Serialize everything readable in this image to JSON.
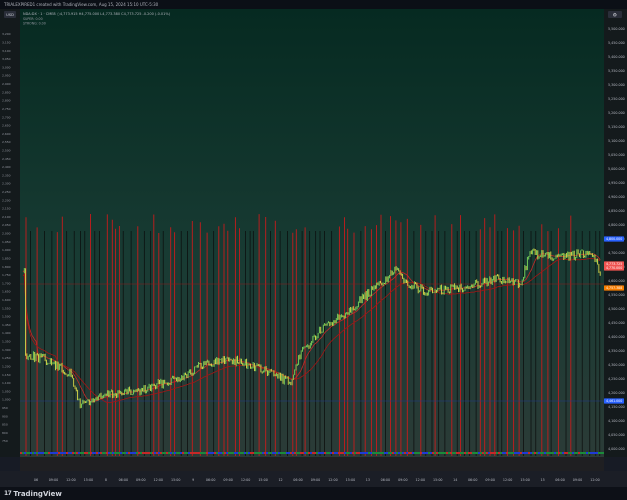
{
  "header": {
    "title": "TRIALEXPIRED1 created with TradingView.com, Aug 15, 2024 15:10 UTC-5:30"
  },
  "chart": {
    "symbol_badge": "USD",
    "legend": {
      "line1": "NDA:DX · 1 · CME8   ○4,773.915  H4,775.000  L4,773.380  C4,773.725  -0.200 (-0.01%)",
      "line2": "SUPER: 0.00",
      "line3": "STRONG: 0.00"
    },
    "price_scale": [
      "5,500.000",
      "5,450.000",
      "5,400.000",
      "5,350.000",
      "5,300.000",
      "5,250.000",
      "5,200.000",
      "5,150.000",
      "5,100.000",
      "5,050.000",
      "5,000.000",
      "4,950.000",
      "4,900.000",
      "4,850.000",
      "4,800.000",
      "4,750.000",
      "4,700.000",
      "4,650.000",
      "4,600.000",
      "4,550.000",
      "4,500.000",
      "4,450.000",
      "4,400.000",
      "4,350.000",
      "4,300.000",
      "4,250.000",
      "4,200.000",
      "4,150.000",
      "4,100.000",
      "4,050.000",
      "4,000.000"
    ],
    "left_scale": [
      "3,200",
      "3,150",
      "3,100",
      "3,050",
      "3,000",
      "2,950",
      "2,900",
      "2,850",
      "2,800",
      "2,750",
      "2,700",
      "2,650",
      "2,600",
      "2,550",
      "2,500",
      "2,450",
      "2,400",
      "2,350",
      "2,300",
      "2,250",
      "2,200",
      "2,150",
      "2,100",
      "2,050",
      "2,000",
      "1,950",
      "1,900",
      "1,850",
      "1,800",
      "1,750",
      "1,700",
      "1,650",
      "1,600",
      "1,550",
      "1,500",
      "1,450",
      "1,400",
      "1,350",
      "1,300",
      "1,250",
      "1,200",
      "1,150",
      "1,100",
      "1,050",
      "1,000",
      "950",
      "900",
      "850",
      "800",
      "750"
    ],
    "price_badges": [
      {
        "label": "4,800.000",
        "color": "#2962ff"
      },
      {
        "label": "4,773.725",
        "color": "#ef5350"
      },
      {
        "label": "4,770.000",
        "color": "#ef5350"
      },
      {
        "label": "4,757.388",
        "color": "#f57c00"
      },
      {
        "label": "4,461.000",
        "color": "#2962ff"
      }
    ],
    "time_axis": [
      "06",
      "09:00",
      "12:00",
      "15:00",
      "8",
      "06:00",
      "09:00",
      "12:00",
      "15:00",
      "9",
      "06:00",
      "09:00",
      "12:00",
      "15:00",
      "12",
      "06:00",
      "09:00",
      "12:00",
      "15:00",
      "13",
      "06:00",
      "09:00",
      "12:00",
      "15:00",
      "14",
      "06:00",
      "09:00",
      "12:00",
      "15:00",
      "15",
      "06:00",
      "09:00",
      "12:00"
    ],
    "colors": {
      "candle_up": "#7cd85a",
      "candle_down": "#e0e04a",
      "red_vline": "#c61c1c",
      "black_vline": "#0a0a0a",
      "ma_line": "#c62828"
    }
  },
  "footer": {
    "brand_logo": "17",
    "brand_name": "TradingView"
  }
}
